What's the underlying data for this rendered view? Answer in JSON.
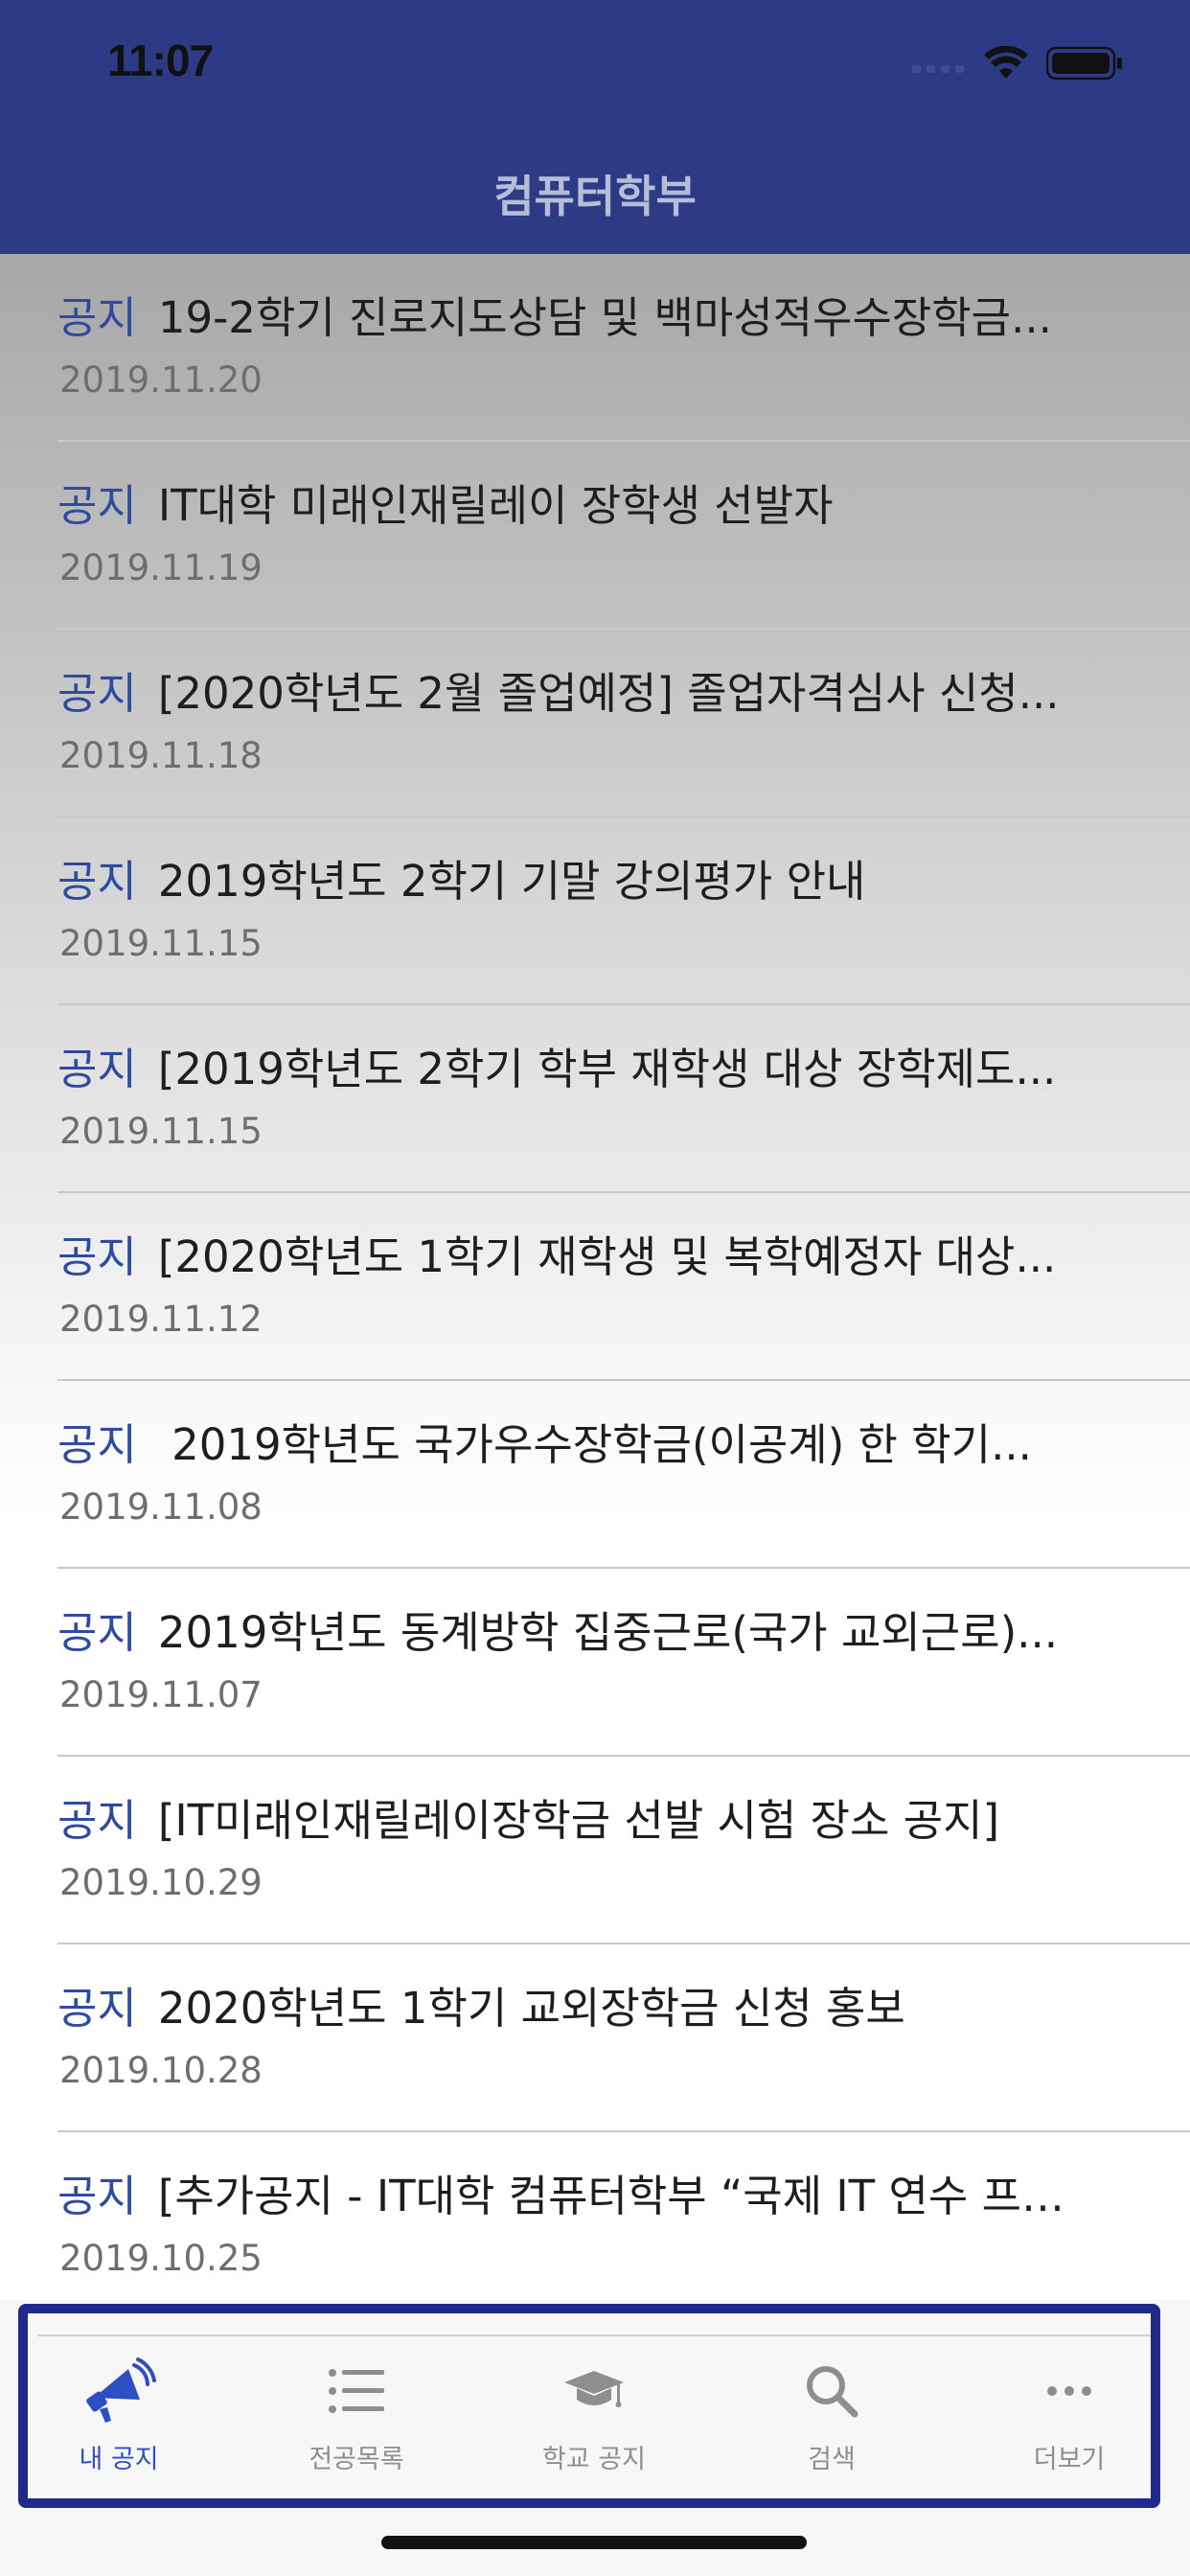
{
  "status": {
    "time": "11:07"
  },
  "header": {
    "title": "컴퓨터학부"
  },
  "notices": [
    {
      "tag": "공지",
      "title": "19-2학기 진로지도상담 및 백마성적우수장학금...",
      "date": "2019.11.20"
    },
    {
      "tag": "공지",
      "title": "IT대학 미래인재릴레이 장학생 선발자",
      "date": "2019.11.19"
    },
    {
      "tag": "공지",
      "title": "[2020학년도 2월 졸업예정] 졸업자격심사 신청...",
      "date": "2019.11.18"
    },
    {
      "tag": "공지",
      "title": "2019학년도 2학기 기말 강의평가 안내",
      "date": "2019.11.15"
    },
    {
      "tag": "공지",
      "title": "[2019학년도 2학기 학부 재학생 대상 장학제도...",
      "date": "2019.11.15"
    },
    {
      "tag": "공지",
      "title": "[2020학년도 1학기 재학생 및 복학예정자 대상...",
      "date": "2019.11.12"
    },
    {
      "tag": "공지",
      "title": " 2019학년도 국가우수장학금(이공계) 한 학기...",
      "date": "2019.11.08"
    },
    {
      "tag": "공지",
      "title": "2019학년도 동계방학 집중근로(국가 교외근로)...",
      "date": "2019.11.07"
    },
    {
      "tag": "공지",
      "title": "[IT미래인재릴레이장학금 선발 시험 장소 공지]",
      "date": "2019.10.29"
    },
    {
      "tag": "공지",
      "title": "2020학년도 1학기 교외장학금 신청 홍보",
      "date": "2019.10.28"
    },
    {
      "tag": "공지",
      "title": "[추가공지 - IT대학 컴퓨터학부 “국제 IT 연수 프…",
      "date": "2019.10.25"
    }
  ],
  "tabbar": {
    "tabs": [
      {
        "label": "내 공지",
        "icon": "megaphone-icon",
        "active": true
      },
      {
        "label": "전공목록",
        "icon": "list-icon",
        "active": false
      },
      {
        "label": "학교 공지",
        "icon": "graduation-cap-icon",
        "active": false
      },
      {
        "label": "검색",
        "icon": "search-icon",
        "active": false
      },
      {
        "label": "더보기",
        "icon": "more-icon",
        "active": false
      }
    ]
  },
  "colors": {
    "nav": "#2d3a86",
    "accent": "#2e4fc4",
    "tag": "#2f4ba0",
    "frame": "#1f2a8c"
  }
}
